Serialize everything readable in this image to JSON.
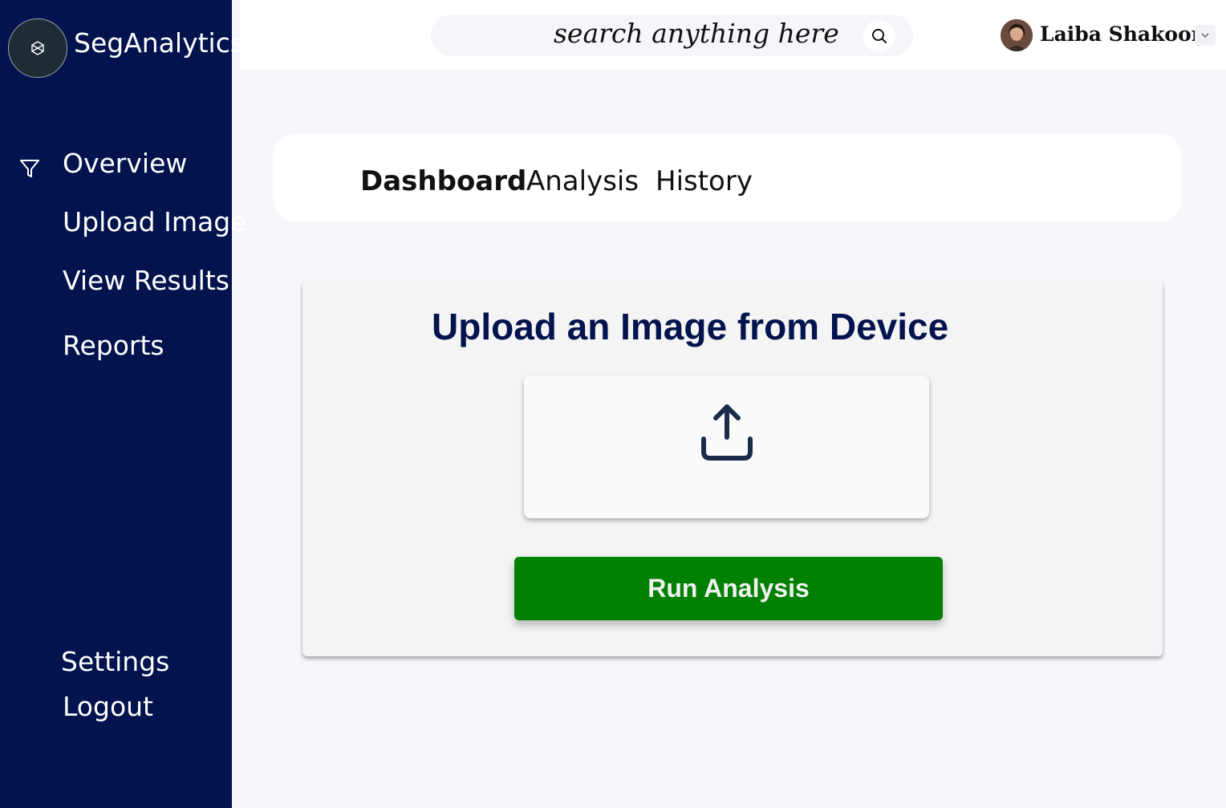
{
  "app": {
    "brand": "SegAnalytics",
    "logo_icon": "hex-logo-icon"
  },
  "sidebar": {
    "items": [
      {
        "label": "Overview",
        "icon": "filter-icon"
      },
      {
        "label": "Upload Image"
      },
      {
        "label": "View Results"
      },
      {
        "label": "Reports"
      }
    ],
    "footer_items": [
      {
        "label": "Settings"
      },
      {
        "label": "Logout"
      }
    ]
  },
  "header": {
    "search_placeholder": "search anything here",
    "search_icon": "search-icon",
    "user_name": "Laiba Shakoor",
    "dropdown_icon": "chevron-down-icon"
  },
  "tabs": [
    {
      "label": "Dashboard",
      "active": true
    },
    {
      "label": "Analysis",
      "active": false
    },
    {
      "label": "History",
      "active": false
    }
  ],
  "upload": {
    "title": "Upload an Image from Device",
    "icon": "upload-icon",
    "run_button": "Run Analysis"
  },
  "colors": {
    "sidebar_bg": "#02134d",
    "title_color": "#02134d",
    "run_button_bg": "#008000",
    "page_bg": "#f6f7fb"
  }
}
